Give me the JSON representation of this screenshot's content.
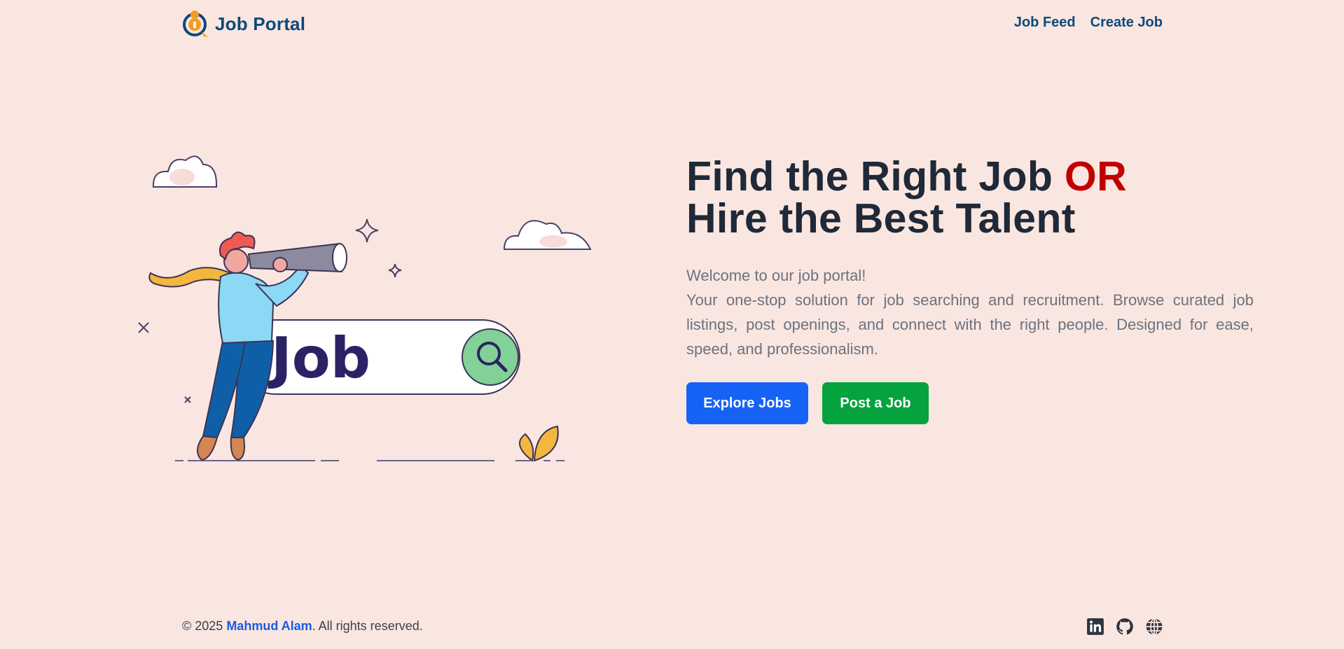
{
  "header": {
    "brand_name": "Job Portal",
    "logo_icon": "job-portal-logo-icon",
    "nav": [
      {
        "label": "Job Feed"
      },
      {
        "label": "Create Job"
      }
    ]
  },
  "illustration": {
    "search_word": "Job",
    "icons": [
      "telescope-person-illustration",
      "search-icon",
      "cloud-icon",
      "sparkle-icon",
      "leaf-icon"
    ]
  },
  "hero": {
    "title_line1": "Find the Right Job ",
    "title_or": "OR",
    "title_line2": "Hire the Best Talent",
    "welcome": "Welcome to our job portal!",
    "description": "Your one-stop solution for job searching and recruitment. Browse curated job listings, post openings, and connect with the right people. Designed for ease, speed, and professionalism.",
    "primary_button": "Explore Jobs",
    "secondary_button": "Post a Job"
  },
  "footer": {
    "copyright_prefix": "© 2025 ",
    "author": "Mahmud Alam",
    "copyright_suffix": ". All rights reserved.",
    "social_icons": [
      "linkedin-icon",
      "github-icon",
      "globe-icon"
    ]
  },
  "colors": {
    "background": "#fae6e0",
    "brand": "#0b4a7a",
    "accent_red": "#c00000",
    "primary_blue": "#1662f5",
    "success_green": "#04a33e",
    "author_link": "#1d5be0"
  }
}
